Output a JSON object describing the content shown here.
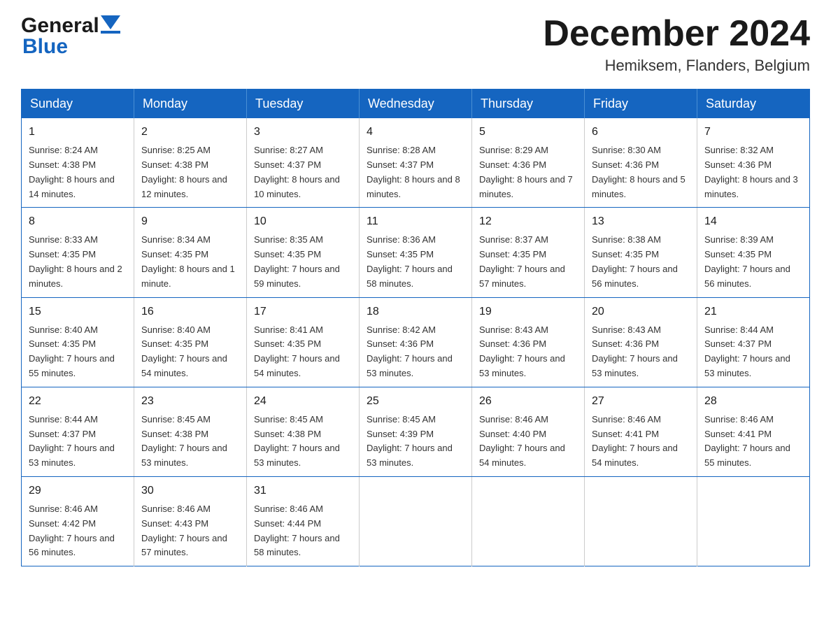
{
  "header": {
    "logo_general": "General",
    "logo_blue": "Blue",
    "month_title": "December 2024",
    "location": "Hemiksem, Flanders, Belgium"
  },
  "calendar": {
    "days_of_week": [
      "Sunday",
      "Monday",
      "Tuesday",
      "Wednesday",
      "Thursday",
      "Friday",
      "Saturday"
    ],
    "weeks": [
      [
        {
          "date": "1",
          "sunrise": "8:24 AM",
          "sunset": "4:38 PM",
          "daylight": "8 hours and 14 minutes."
        },
        {
          "date": "2",
          "sunrise": "8:25 AM",
          "sunset": "4:38 PM",
          "daylight": "8 hours and 12 minutes."
        },
        {
          "date": "3",
          "sunrise": "8:27 AM",
          "sunset": "4:37 PM",
          "daylight": "8 hours and 10 minutes."
        },
        {
          "date": "4",
          "sunrise": "8:28 AM",
          "sunset": "4:37 PM",
          "daylight": "8 hours and 8 minutes."
        },
        {
          "date": "5",
          "sunrise": "8:29 AM",
          "sunset": "4:36 PM",
          "daylight": "8 hours and 7 minutes."
        },
        {
          "date": "6",
          "sunrise": "8:30 AM",
          "sunset": "4:36 PM",
          "daylight": "8 hours and 5 minutes."
        },
        {
          "date": "7",
          "sunrise": "8:32 AM",
          "sunset": "4:36 PM",
          "daylight": "8 hours and 3 minutes."
        }
      ],
      [
        {
          "date": "8",
          "sunrise": "8:33 AM",
          "sunset": "4:35 PM",
          "daylight": "8 hours and 2 minutes."
        },
        {
          "date": "9",
          "sunrise": "8:34 AM",
          "sunset": "4:35 PM",
          "daylight": "8 hours and 1 minute."
        },
        {
          "date": "10",
          "sunrise": "8:35 AM",
          "sunset": "4:35 PM",
          "daylight": "7 hours and 59 minutes."
        },
        {
          "date": "11",
          "sunrise": "8:36 AM",
          "sunset": "4:35 PM",
          "daylight": "7 hours and 58 minutes."
        },
        {
          "date": "12",
          "sunrise": "8:37 AM",
          "sunset": "4:35 PM",
          "daylight": "7 hours and 57 minutes."
        },
        {
          "date": "13",
          "sunrise": "8:38 AM",
          "sunset": "4:35 PM",
          "daylight": "7 hours and 56 minutes."
        },
        {
          "date": "14",
          "sunrise": "8:39 AM",
          "sunset": "4:35 PM",
          "daylight": "7 hours and 56 minutes."
        }
      ],
      [
        {
          "date": "15",
          "sunrise": "8:40 AM",
          "sunset": "4:35 PM",
          "daylight": "7 hours and 55 minutes."
        },
        {
          "date": "16",
          "sunrise": "8:40 AM",
          "sunset": "4:35 PM",
          "daylight": "7 hours and 54 minutes."
        },
        {
          "date": "17",
          "sunrise": "8:41 AM",
          "sunset": "4:35 PM",
          "daylight": "7 hours and 54 minutes."
        },
        {
          "date": "18",
          "sunrise": "8:42 AM",
          "sunset": "4:36 PM",
          "daylight": "7 hours and 53 minutes."
        },
        {
          "date": "19",
          "sunrise": "8:43 AM",
          "sunset": "4:36 PM",
          "daylight": "7 hours and 53 minutes."
        },
        {
          "date": "20",
          "sunrise": "8:43 AM",
          "sunset": "4:36 PM",
          "daylight": "7 hours and 53 minutes."
        },
        {
          "date": "21",
          "sunrise": "8:44 AM",
          "sunset": "4:37 PM",
          "daylight": "7 hours and 53 minutes."
        }
      ],
      [
        {
          "date": "22",
          "sunrise": "8:44 AM",
          "sunset": "4:37 PM",
          "daylight": "7 hours and 53 minutes."
        },
        {
          "date": "23",
          "sunrise": "8:45 AM",
          "sunset": "4:38 PM",
          "daylight": "7 hours and 53 minutes."
        },
        {
          "date": "24",
          "sunrise": "8:45 AM",
          "sunset": "4:38 PM",
          "daylight": "7 hours and 53 minutes."
        },
        {
          "date": "25",
          "sunrise": "8:45 AM",
          "sunset": "4:39 PM",
          "daylight": "7 hours and 53 minutes."
        },
        {
          "date": "26",
          "sunrise": "8:46 AM",
          "sunset": "4:40 PM",
          "daylight": "7 hours and 54 minutes."
        },
        {
          "date": "27",
          "sunrise": "8:46 AM",
          "sunset": "4:41 PM",
          "daylight": "7 hours and 54 minutes."
        },
        {
          "date": "28",
          "sunrise": "8:46 AM",
          "sunset": "4:41 PM",
          "daylight": "7 hours and 55 minutes."
        }
      ],
      [
        {
          "date": "29",
          "sunrise": "8:46 AM",
          "sunset": "4:42 PM",
          "daylight": "7 hours and 56 minutes."
        },
        {
          "date": "30",
          "sunrise": "8:46 AM",
          "sunset": "4:43 PM",
          "daylight": "7 hours and 57 minutes."
        },
        {
          "date": "31",
          "sunrise": "8:46 AM",
          "sunset": "4:44 PM",
          "daylight": "7 hours and 58 minutes."
        },
        null,
        null,
        null,
        null
      ]
    ]
  }
}
